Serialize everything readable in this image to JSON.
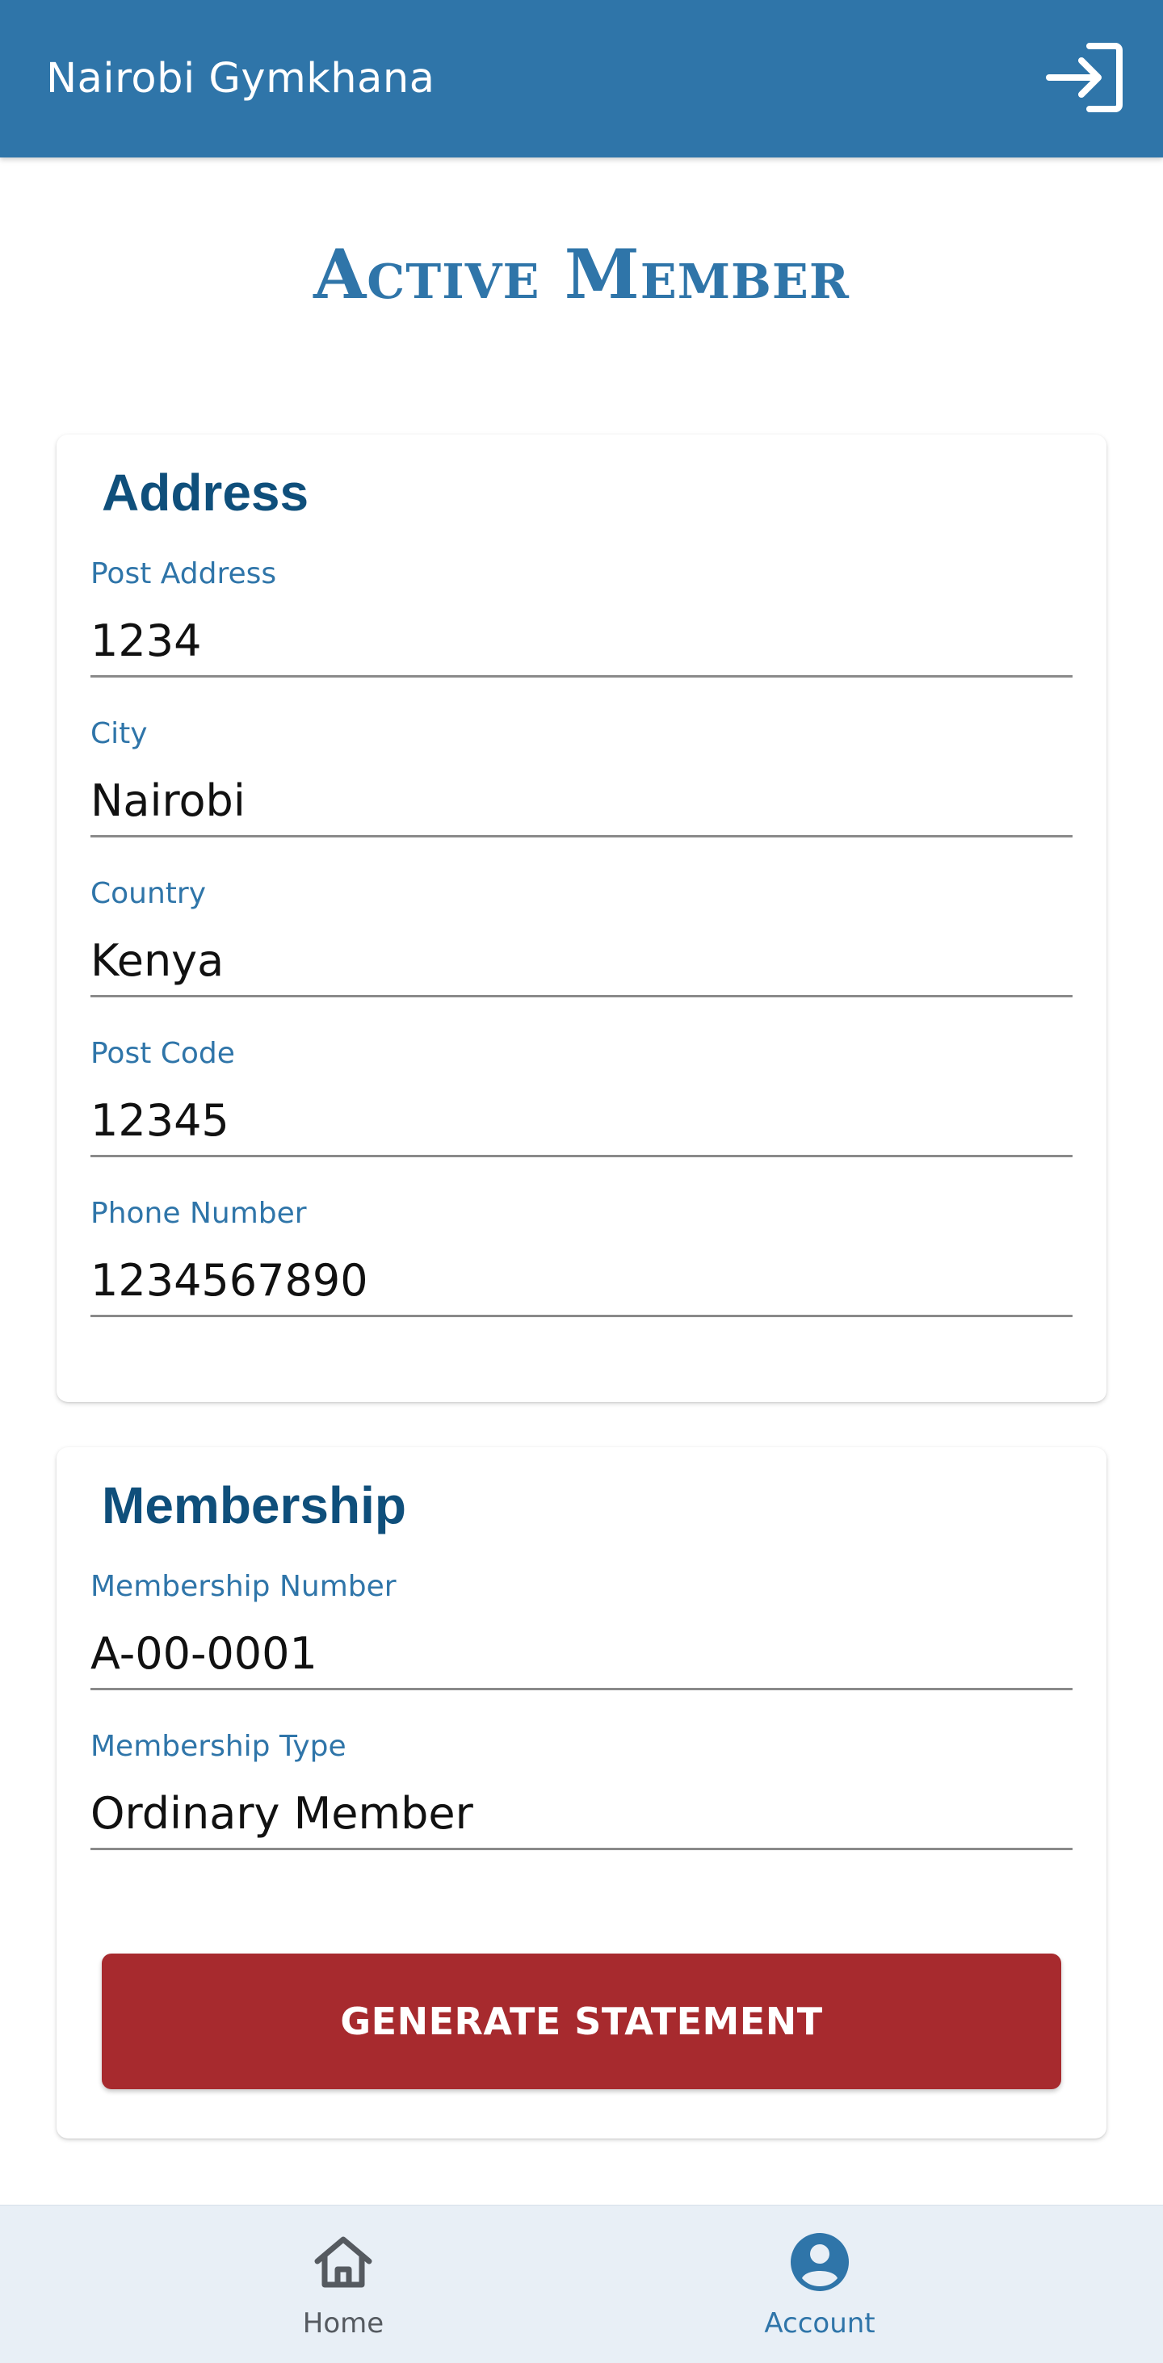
{
  "header": {
    "title": "Nairobi Gymkhana",
    "action_icon": "login-icon"
  },
  "page": {
    "title": "Active Member"
  },
  "address": {
    "heading": "Address",
    "fields": [
      {
        "label": "Post Address",
        "value": "1234"
      },
      {
        "label": "City",
        "value": "Nairobi"
      },
      {
        "label": "Country",
        "value": "Kenya"
      },
      {
        "label": "Post Code",
        "value": "12345"
      },
      {
        "label": "Phone Number",
        "value": "1234567890"
      }
    ]
  },
  "membership": {
    "heading": "Membership",
    "fields": [
      {
        "label": "Membership Number",
        "value": "A-00-0001"
      },
      {
        "label": "Membership Type",
        "value": "Ordinary Member"
      }
    ],
    "button_label": "GENERATE STATEMENT"
  },
  "bottom_nav": {
    "items": [
      {
        "label": "Home",
        "icon": "home-icon",
        "active": false
      },
      {
        "label": "Account",
        "icon": "account-circle-icon",
        "active": true
      }
    ]
  },
  "colors": {
    "primary": "#2f75a9",
    "heading": "#0f4f7b",
    "button": "#a72a2e",
    "nav_background": "#e8eff6"
  }
}
